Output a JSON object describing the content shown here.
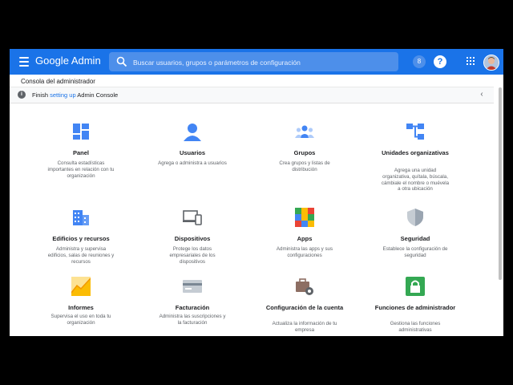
{
  "header": {
    "brand_google": "Google",
    "brand_admin": "Admin",
    "search_placeholder": "Buscar usuarios, grupos o parámetros de configuración"
  },
  "breadcrumb": "Consola del administrador",
  "banner": {
    "pre": "Finish ",
    "link": "setting up",
    "post": " Admin Console"
  },
  "cards": [
    {
      "title": "Panel",
      "desc": "Consulta estadísticas importantes en relación con tu organización",
      "icon": "dashboard-icon"
    },
    {
      "title": "Usuarios",
      "desc": "Agrega o administra a usuarios",
      "icon": "user-icon"
    },
    {
      "title": "Grupos",
      "desc": "Crea grupos y listas de distribución",
      "icon": "groups-icon"
    },
    {
      "title": "Unidades organizativas",
      "desc": "Agrega una unidad organizativa, quítala, búscala, cámbiale el nombre o muévela a otra ubicación",
      "icon": "org-units-icon"
    },
    {
      "title": "Edificios y recursos",
      "desc": "Administra y supervisa edificios, salas de reuniones y recursos",
      "icon": "buildings-icon"
    },
    {
      "title": "Dispositivos",
      "desc": "Protege los datos empresariales de los dispositivos",
      "icon": "devices-icon"
    },
    {
      "title": "Apps",
      "desc": "Administra las apps y sus configuraciones",
      "icon": "apps-icon"
    },
    {
      "title": "Seguridad",
      "desc": "Establece la configuración de seguridad",
      "icon": "security-shield-icon"
    },
    {
      "title": "Informes",
      "desc": "Supervisa el uso en toda tu organización",
      "icon": "reports-chart-icon"
    },
    {
      "title": "Facturación",
      "desc": "Administra las suscripciones y la facturación",
      "icon": "billing-card-icon"
    },
    {
      "title": "Configuración de la cuenta",
      "desc": "Actualiza la información de tu empresa",
      "icon": "account-settings-icon"
    },
    {
      "title": "Funciones de administrador",
      "desc": "Gestiona las funciones administrativas",
      "icon": "admin-roles-lock-icon"
    }
  ],
  "colors": {
    "appbar": "#1a73e8",
    "icon_blue": "#4285f4",
    "title": "#202124",
    "desc": "#5f6368"
  }
}
